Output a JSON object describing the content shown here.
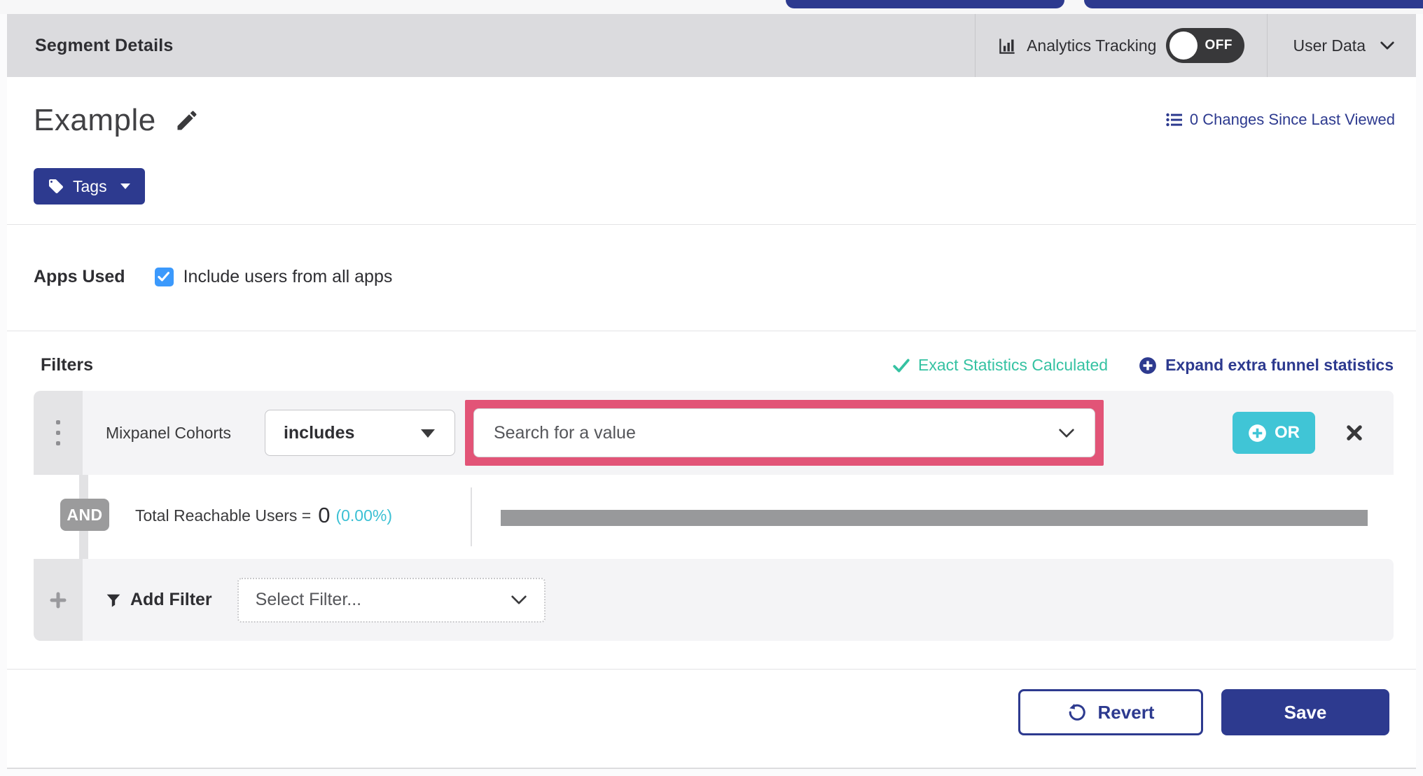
{
  "header": {
    "title": "Segment Details",
    "analytics_label": "Analytics Tracking",
    "toggle_state": "OFF",
    "user_data_label": "User Data"
  },
  "segment": {
    "name": "Example",
    "changes_link": "0 Changes Since Last Viewed",
    "tags_label": "Tags"
  },
  "apps": {
    "label": "Apps Used",
    "checkbox_label": "Include users from all apps",
    "checked": true
  },
  "filters": {
    "title": "Filters",
    "exact_stats_label": "Exact Statistics Calculated",
    "expand_label": "Expand extra funnel statistics",
    "row": {
      "field": "Mixpanel Cohorts",
      "operator": "includes",
      "value_placeholder": "Search for a value",
      "or_label": "OR"
    },
    "and_label": "AND",
    "reachable_label": "Total Reachable Users =",
    "reachable_value": "0",
    "reachable_percent": "(0.00%)",
    "add_filter_label": "Add Filter",
    "select_filter_placeholder": "Select Filter..."
  },
  "footer": {
    "revert_label": "Revert",
    "save_label": "Save"
  },
  "colors": {
    "navy": "#2d3a8f",
    "teal_button": "#40c5d6",
    "teal_text": "#35c2a2",
    "cyan_percent": "#3bc0d4",
    "pink_highlight": "#e25477",
    "checkbox_blue": "#3b99fc",
    "header_gray": "#dbdbde",
    "row_gray": "#f4f4f6",
    "rail_gray": "#e4e4e6",
    "bar_gray": "#98999b"
  }
}
